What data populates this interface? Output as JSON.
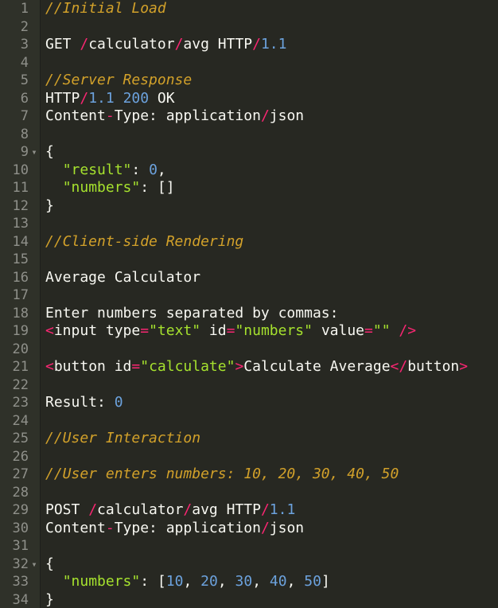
{
  "editor": {
    "lines": [
      {
        "n": "1",
        "fold": "",
        "tokens": [
          {
            "t": "//Initial Load",
            "c": "comment"
          }
        ]
      },
      {
        "n": "2",
        "fold": "",
        "tokens": []
      },
      {
        "n": "3",
        "fold": "",
        "tokens": [
          {
            "t": "GET ",
            "c": "text"
          },
          {
            "t": "/",
            "c": "op"
          },
          {
            "t": "calculator",
            "c": "text"
          },
          {
            "t": "/",
            "c": "op"
          },
          {
            "t": "avg HTTP",
            "c": "text"
          },
          {
            "t": "/",
            "c": "op"
          },
          {
            "t": "1.1",
            "c": "num"
          }
        ]
      },
      {
        "n": "4",
        "fold": "",
        "tokens": []
      },
      {
        "n": "5",
        "fold": "",
        "tokens": [
          {
            "t": "//Server Response",
            "c": "comment"
          }
        ]
      },
      {
        "n": "6",
        "fold": "",
        "tokens": [
          {
            "t": "HTTP",
            "c": "text"
          },
          {
            "t": "/",
            "c": "op"
          },
          {
            "t": "1.1",
            "c": "num"
          },
          {
            "t": " ",
            "c": "text"
          },
          {
            "t": "200",
            "c": "num"
          },
          {
            "t": " OK",
            "c": "text"
          }
        ]
      },
      {
        "n": "7",
        "fold": "",
        "tokens": [
          {
            "t": "Content",
            "c": "text"
          },
          {
            "t": "-",
            "c": "op"
          },
          {
            "t": "Type: application",
            "c": "text"
          },
          {
            "t": "/",
            "c": "op"
          },
          {
            "t": "json",
            "c": "text"
          }
        ]
      },
      {
        "n": "8",
        "fold": "",
        "tokens": []
      },
      {
        "n": "9",
        "fold": "▾",
        "tokens": [
          {
            "t": "{",
            "c": "text"
          }
        ]
      },
      {
        "n": "10",
        "fold": "",
        "tokens": [
          {
            "t": "  ",
            "c": "text"
          },
          {
            "t": "\"result\"",
            "c": "str"
          },
          {
            "t": ": ",
            "c": "text"
          },
          {
            "t": "0",
            "c": "num"
          },
          {
            "t": ",",
            "c": "text"
          }
        ]
      },
      {
        "n": "11",
        "fold": "",
        "tokens": [
          {
            "t": "  ",
            "c": "text"
          },
          {
            "t": "\"numbers\"",
            "c": "str"
          },
          {
            "t": ": []",
            "c": "text"
          }
        ]
      },
      {
        "n": "12",
        "fold": "",
        "tokens": [
          {
            "t": "}",
            "c": "text"
          }
        ]
      },
      {
        "n": "13",
        "fold": "",
        "tokens": []
      },
      {
        "n": "14",
        "fold": "",
        "tokens": [
          {
            "t": "//Client-side Rendering",
            "c": "comment"
          }
        ]
      },
      {
        "n": "15",
        "fold": "",
        "tokens": []
      },
      {
        "n": "16",
        "fold": "",
        "tokens": [
          {
            "t": "Average Calculator",
            "c": "text"
          }
        ]
      },
      {
        "n": "17",
        "fold": "",
        "tokens": []
      },
      {
        "n": "18",
        "fold": "",
        "tokens": [
          {
            "t": "Enter numbers separated by commas:",
            "c": "text"
          }
        ]
      },
      {
        "n": "19",
        "fold": "",
        "tokens": [
          {
            "t": "<",
            "c": "tag"
          },
          {
            "t": "input type",
            "c": "text"
          },
          {
            "t": "=",
            "c": "op"
          },
          {
            "t": "\"text\"",
            "c": "str"
          },
          {
            "t": " id",
            "c": "text"
          },
          {
            "t": "=",
            "c": "op"
          },
          {
            "t": "\"numbers\"",
            "c": "str"
          },
          {
            "t": " value",
            "c": "text"
          },
          {
            "t": "=",
            "c": "op"
          },
          {
            "t": "\"\"",
            "c": "str"
          },
          {
            "t": " ",
            "c": "text"
          },
          {
            "t": "/>",
            "c": "tag"
          }
        ]
      },
      {
        "n": "20",
        "fold": "",
        "tokens": []
      },
      {
        "n": "21",
        "fold": "",
        "tokens": [
          {
            "t": "<",
            "c": "tag"
          },
          {
            "t": "button id",
            "c": "text"
          },
          {
            "t": "=",
            "c": "op"
          },
          {
            "t": "\"calculate\"",
            "c": "str"
          },
          {
            "t": ">",
            "c": "tag"
          },
          {
            "t": "Calculate Average",
            "c": "text"
          },
          {
            "t": "</",
            "c": "tag"
          },
          {
            "t": "button",
            "c": "text"
          },
          {
            "t": ">",
            "c": "tag"
          }
        ]
      },
      {
        "n": "22",
        "fold": "",
        "tokens": []
      },
      {
        "n": "23",
        "fold": "",
        "tokens": [
          {
            "t": "Result: ",
            "c": "text"
          },
          {
            "t": "0",
            "c": "num"
          }
        ]
      },
      {
        "n": "24",
        "fold": "",
        "tokens": []
      },
      {
        "n": "25",
        "fold": "",
        "tokens": [
          {
            "t": "//User Interaction",
            "c": "comment"
          }
        ]
      },
      {
        "n": "26",
        "fold": "",
        "tokens": []
      },
      {
        "n": "27",
        "fold": "",
        "tokens": [
          {
            "t": "//User enters numbers: 10, 20, 30, 40, 50",
            "c": "comment"
          }
        ]
      },
      {
        "n": "28",
        "fold": "",
        "tokens": []
      },
      {
        "n": "29",
        "fold": "",
        "tokens": [
          {
            "t": "POST ",
            "c": "text"
          },
          {
            "t": "/",
            "c": "op"
          },
          {
            "t": "calculator",
            "c": "text"
          },
          {
            "t": "/",
            "c": "op"
          },
          {
            "t": "avg HTTP",
            "c": "text"
          },
          {
            "t": "/",
            "c": "op"
          },
          {
            "t": "1.1",
            "c": "num"
          }
        ]
      },
      {
        "n": "30",
        "fold": "",
        "tokens": [
          {
            "t": "Content",
            "c": "text"
          },
          {
            "t": "-",
            "c": "op"
          },
          {
            "t": "Type: application",
            "c": "text"
          },
          {
            "t": "/",
            "c": "op"
          },
          {
            "t": "json",
            "c": "text"
          }
        ]
      },
      {
        "n": "31",
        "fold": "",
        "tokens": []
      },
      {
        "n": "32",
        "fold": "▾",
        "tokens": [
          {
            "t": "{",
            "c": "text"
          }
        ]
      },
      {
        "n": "33",
        "fold": "",
        "tokens": [
          {
            "t": "  ",
            "c": "text"
          },
          {
            "t": "\"numbers\"",
            "c": "str"
          },
          {
            "t": ": [",
            "c": "text"
          },
          {
            "t": "10",
            "c": "num"
          },
          {
            "t": ", ",
            "c": "text"
          },
          {
            "t": "20",
            "c": "num"
          },
          {
            "t": ", ",
            "c": "text"
          },
          {
            "t": "30",
            "c": "num"
          },
          {
            "t": ", ",
            "c": "text"
          },
          {
            "t": "40",
            "c": "num"
          },
          {
            "t": ", ",
            "c": "text"
          },
          {
            "t": "50",
            "c": "num"
          },
          {
            "t": "]",
            "c": "text"
          }
        ]
      },
      {
        "n": "34",
        "fold": "",
        "tokens": [
          {
            "t": "}",
            "c": "text"
          }
        ]
      }
    ]
  }
}
